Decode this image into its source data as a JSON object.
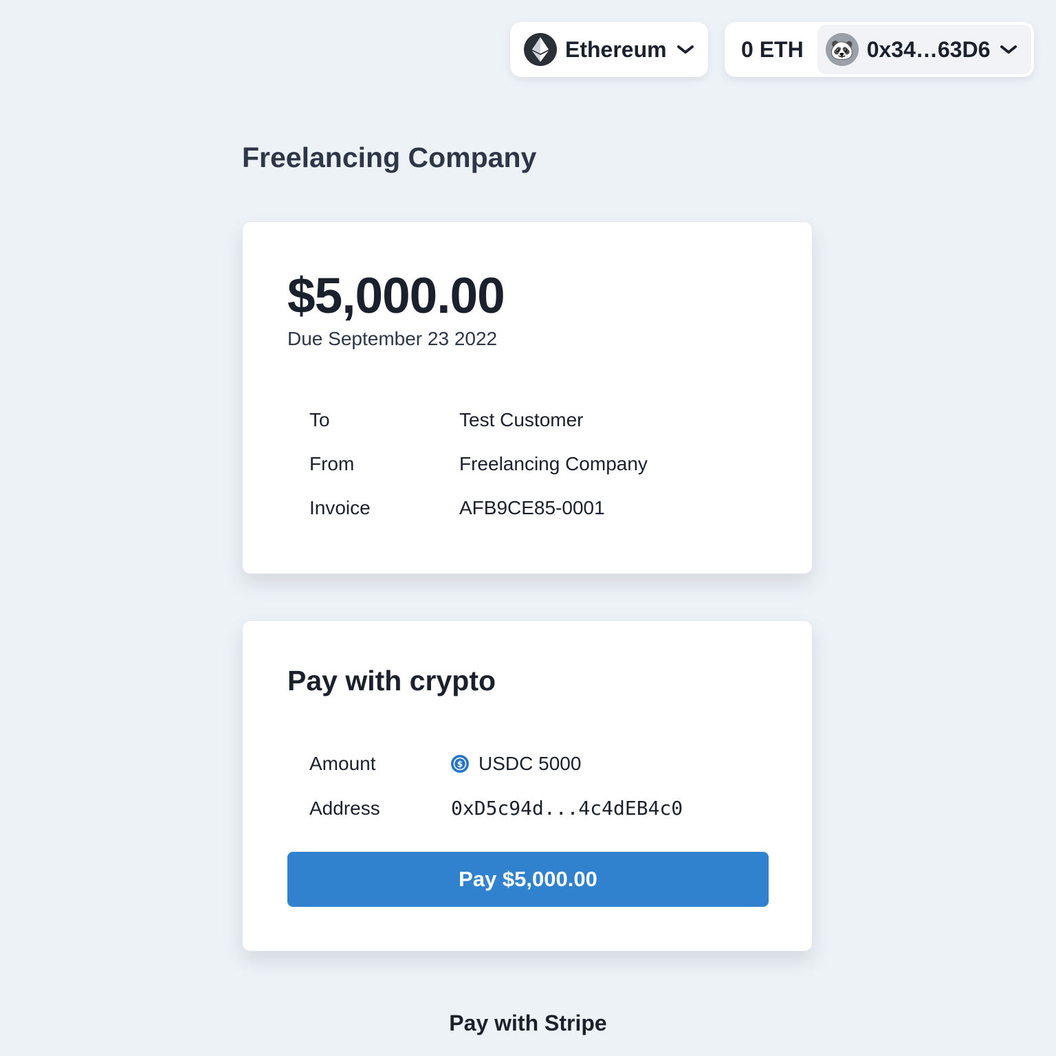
{
  "header": {
    "network_label": "Ethereum",
    "network_icon": "ethereum-icon",
    "balance": "0 ETH",
    "account_address": "0x34…63D6",
    "avatar_emoji": "🐼"
  },
  "page": {
    "company_title": "Freelancing Company"
  },
  "invoice": {
    "amount": "$5,000.00",
    "due": "Due September 23 2022",
    "rows": [
      {
        "label": "To",
        "value": "Test Customer"
      },
      {
        "label": "From",
        "value": "Freelancing Company"
      },
      {
        "label": "Invoice",
        "value": "AFB9CE85-0001"
      }
    ]
  },
  "crypto": {
    "heading": "Pay with crypto",
    "amount_label": "Amount",
    "amount_value": "USDC 5000",
    "token_icon": "usdc-icon",
    "address_label": "Address",
    "address_value": "0xD5c94d...4c4dEB4c0",
    "pay_button": "Pay $5,000.00"
  },
  "stripe": {
    "link_label": "Pay with Stripe"
  },
  "colors": {
    "background": "#edf2f7",
    "accent": "#3182ce",
    "text": "#1a202c"
  }
}
